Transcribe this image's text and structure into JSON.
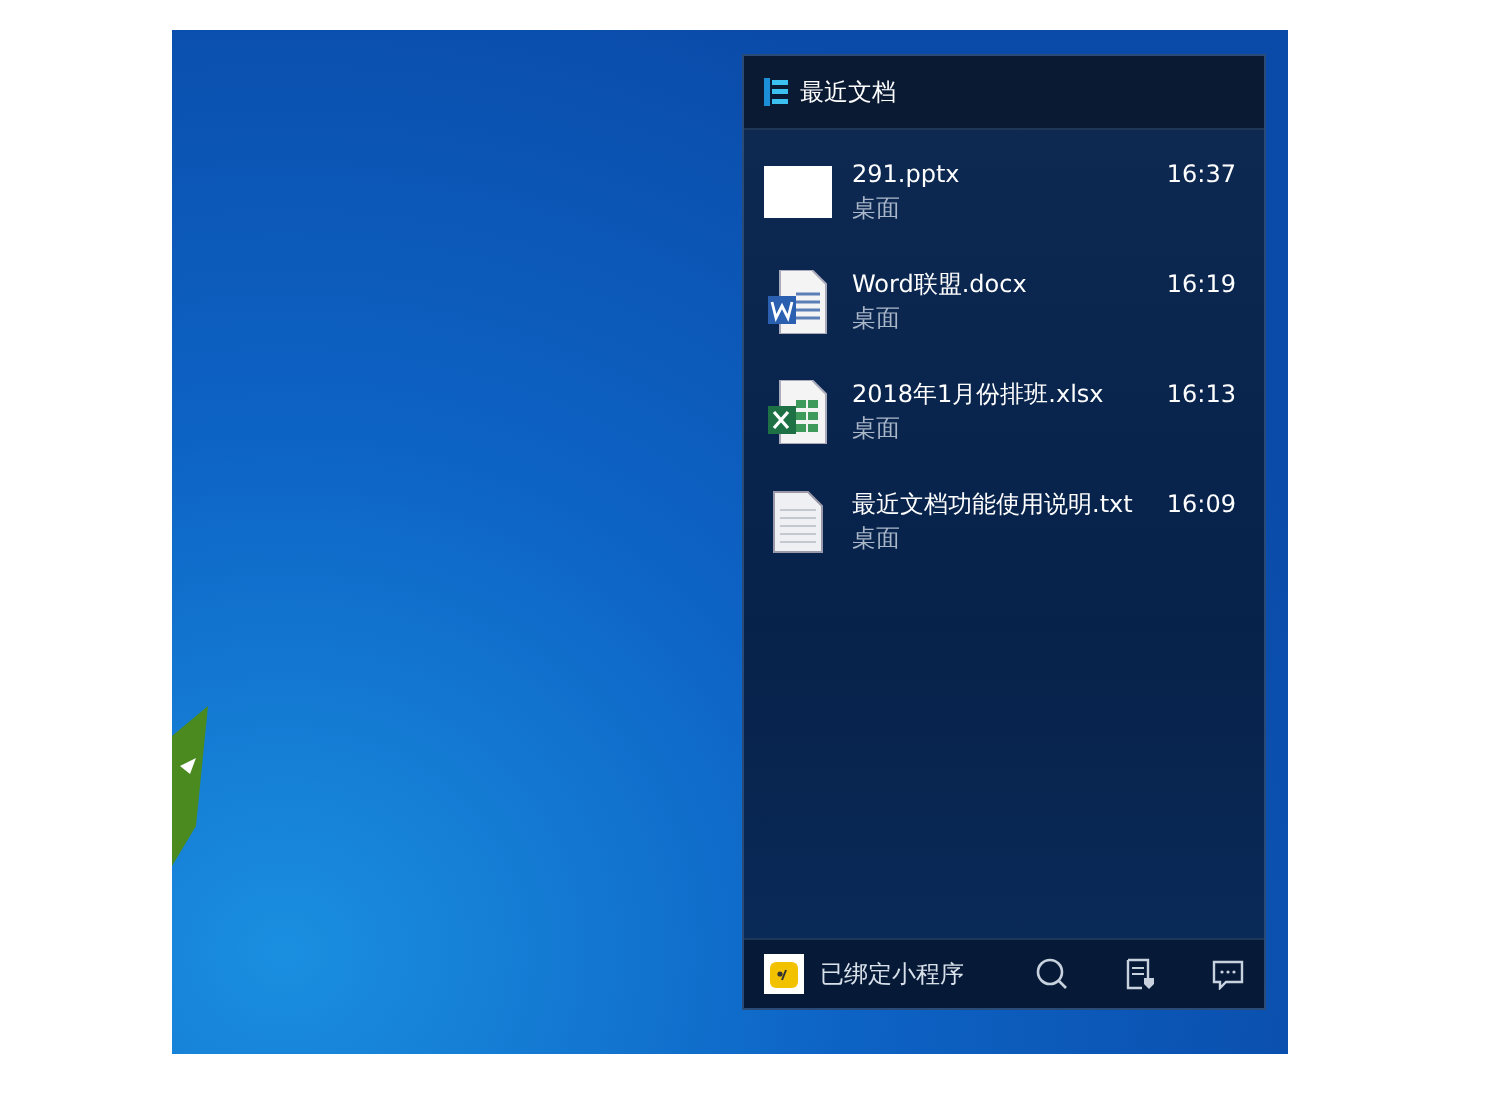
{
  "panel": {
    "title": "最近文档"
  },
  "files": [
    {
      "kind": "blank",
      "name": "291.pptx",
      "location": "桌面",
      "time": "16:37"
    },
    {
      "kind": "word",
      "name": "Word联盟.docx",
      "location": "桌面",
      "time": "16:19"
    },
    {
      "kind": "excel",
      "name": "2018年1月份排班.xlsx",
      "location": "桌面",
      "time": "16:13"
    },
    {
      "kind": "text",
      "name": "最近文档功能使用说明.txt",
      "location": "桌面",
      "time": "16:09"
    }
  ],
  "footer": {
    "label": "已绑定小程序"
  }
}
